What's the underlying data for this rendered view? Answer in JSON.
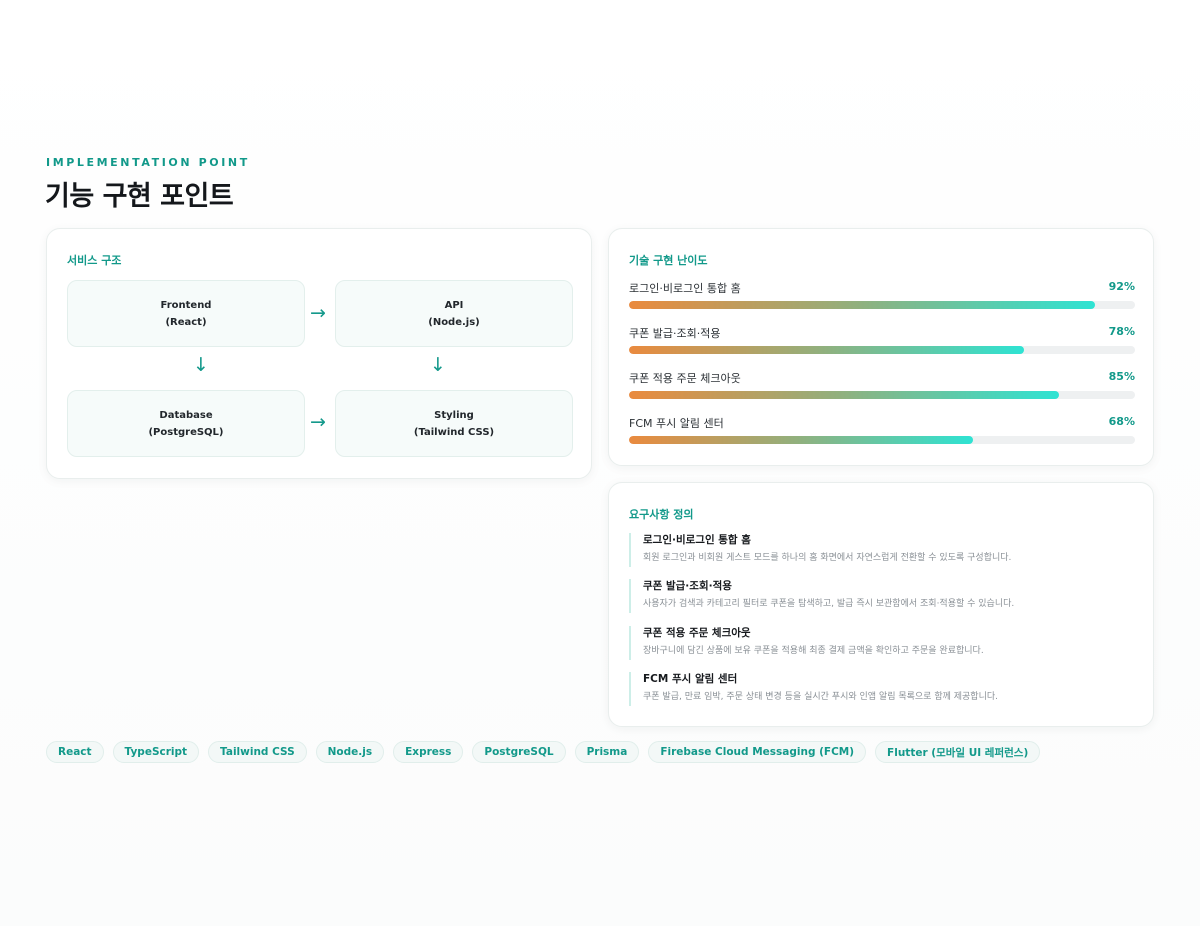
{
  "header": {
    "eyebrow": "IMPLEMENTATION POINT",
    "title": "기능 구현 포인트"
  },
  "architecture": {
    "title": "서비스 구조",
    "nodes": [
      {
        "name": "Frontend",
        "detail": "(React)"
      },
      {
        "name": "API",
        "detail": "(Node.js)"
      },
      {
        "name": "Database",
        "detail": "(PostgreSQL)"
      },
      {
        "name": "Styling",
        "detail": "(Tailwind CSS)"
      }
    ],
    "arrow_right": "→",
    "arrow_down": "↓"
  },
  "difficulty": {
    "title": "기술 구현 난이도",
    "items": [
      {
        "label": "로그인·비로그인 통합 홈",
        "value": "92%",
        "percent": 92
      },
      {
        "label": "쿠폰 발급·조회·적용",
        "value": "78%",
        "percent": 78
      },
      {
        "label": "쿠폰 적용 주문 체크아웃",
        "value": "85%",
        "percent": 85
      },
      {
        "label": "FCM 푸시 알림 센터",
        "value": "68%",
        "percent": 68
      }
    ]
  },
  "requirements": {
    "title": "요구사항 정의",
    "items": [
      {
        "title": "로그인·비로그인 통합 홈",
        "desc": "회원 로그인과 비회원 게스트 모드를 하나의 홈 화면에서 자연스럽게 전환할 수 있도록 구성합니다."
      },
      {
        "title": "쿠폰 발급·조회·적용",
        "desc": "사용자가 검색과 카테고리 필터로 쿠폰을 탐색하고, 발급 즉시 보관함에서 조회·적용할 수 있습니다."
      },
      {
        "title": "쿠폰 적용 주문 체크아웃",
        "desc": "장바구니에 담긴 상품에 보유 쿠폰을 적용해 최종 결제 금액을 확인하고 주문을 완료합니다."
      },
      {
        "title": "FCM 푸시 알림 센터",
        "desc": "쿠폰 발급, 만료 임박, 주문 상태 변경 등을 실시간 푸시와 인앱 알림 목록으로 함께 제공합니다."
      }
    ]
  },
  "tags": [
    "React",
    "TypeScript",
    "Tailwind CSS",
    "Node.js",
    "Express",
    "PostgreSQL",
    "Prisma",
    "Firebase Cloud Messaging (FCM)",
    "Flutter (모바일 UI 레퍼런스)"
  ],
  "colors": {
    "accent": "#12998a",
    "bar_start": "#ea8a3e",
    "bar_end": "#2ee3d3",
    "track": "#eef0f1"
  }
}
